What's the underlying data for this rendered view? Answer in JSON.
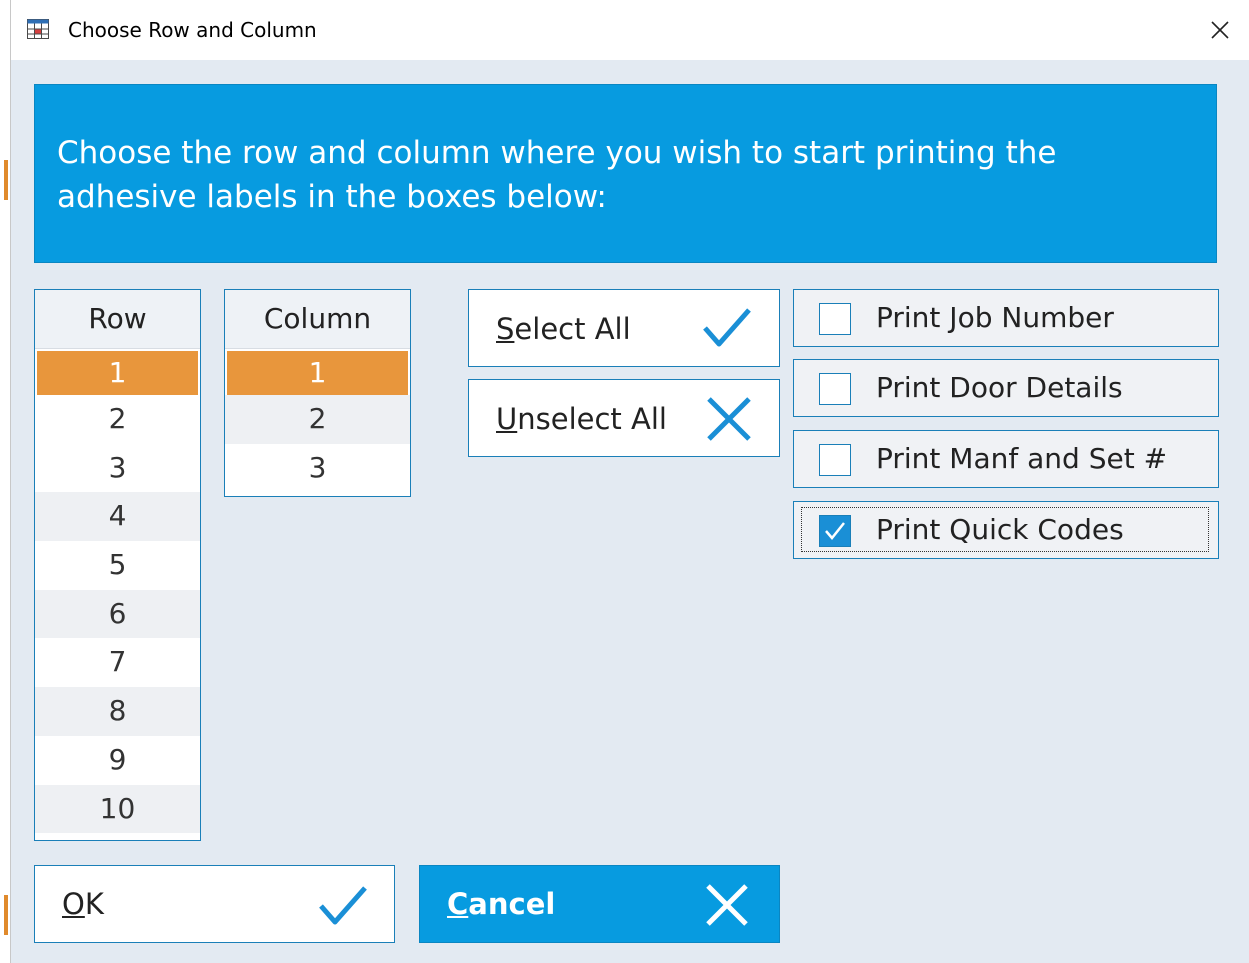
{
  "window": {
    "title": "Choose Row and Column",
    "close_glyph": "✕",
    "app_icon": "grid-window-icon"
  },
  "banner": {
    "text": "Choose the row and column where you wish to start printing the adhesive labels in the boxes below:",
    "color": "#079be0"
  },
  "row_list": {
    "header": "Row",
    "items": [
      "1",
      "2",
      "3",
      "4",
      "5",
      "6",
      "7",
      "8",
      "9",
      "10"
    ],
    "selected": "1"
  },
  "column_list": {
    "header": "Column",
    "items": [
      "1",
      "2",
      "3"
    ],
    "selected": "1"
  },
  "select_all": {
    "mnemonic": "S",
    "rest": "elect All",
    "icon": "check-icon"
  },
  "unselect_all": {
    "mnemonic": "U",
    "rest": "nselect All",
    "icon": "cross-icon"
  },
  "options": [
    {
      "label": "Print Job Number",
      "checked": false
    },
    {
      "label": "Print Door Details",
      "checked": false
    },
    {
      "label": "Print Manf and Set #",
      "checked": false
    },
    {
      "label": "Print Quick Codes",
      "checked": true
    }
  ],
  "ok_button": {
    "mnemonic": "O",
    "rest": "K",
    "icon": "check-icon"
  },
  "cancel_button": {
    "mnemonic": "C",
    "rest": "ancel",
    "icon": "cross-icon"
  },
  "colors": {
    "accent": "#079be0",
    "selection": "#e8963c",
    "border": "#1a7fb8"
  }
}
